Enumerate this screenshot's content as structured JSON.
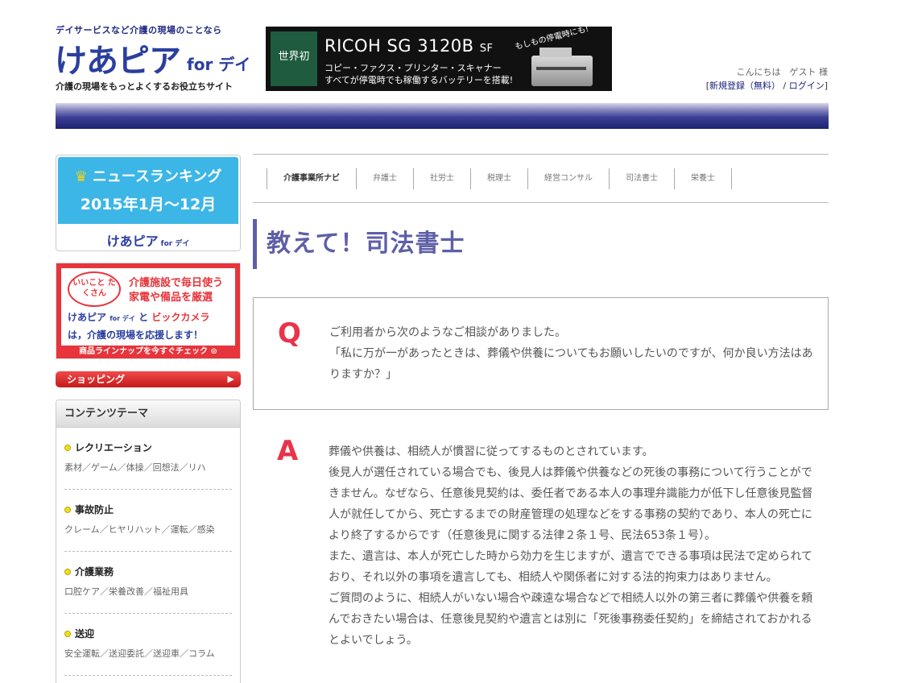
{
  "header": {
    "tagline": "デイサービスなど介護の現場のことなら",
    "logo_main": "けあピア",
    "logo_for": "for デイ",
    "logo_sub": "介護の現場をもっとよくするお役立ちサイト",
    "greeting": "こんにちは　ゲスト 様",
    "register_label": "新規登録（無料）",
    "login_label": "ログイン"
  },
  "banner": {
    "badge": "世界初",
    "title": "RICOH SG 3120B",
    "title_suffix": "SF",
    "line1": "コピー・ファクス・プリンター・スキャナー",
    "line2": "すべてが停電時でも稼働するバッテリーを搭載!",
    "callout": "もしもの停電時にも!"
  },
  "sidebar": {
    "ranking": {
      "title": "ニュースランキング",
      "period": "2015年1月〜12月",
      "logo": "けあピア",
      "logo_for": "for デイ"
    },
    "ad": {
      "bubble": "いいこと たくさん",
      "headline_1": "介護施設で毎日使う",
      "headline_2": "家電や備品を厳選",
      "partner_line_a": "けあピア",
      "partner_line_for": "for デイ",
      "partner_line_b": "と",
      "partner_brand": "ビックカメラ",
      "support_line": "は，介護の現場を応援します！",
      "cta": "商品ラインナップを今すぐチェック"
    },
    "shopping_label": "ショッピング",
    "theme": {
      "heading": "コンテンツテーマ",
      "items": [
        {
          "title": "レクリエーション",
          "sub": "素材／ゲーム／体操／回想法／リハ"
        },
        {
          "title": "事故防止",
          "sub": "クレーム／ヒヤリハット／運転／感染"
        },
        {
          "title": "介護業務",
          "sub": "口腔ケア／栄養改善／福祉用具"
        },
        {
          "title": "送迎",
          "sub": "安全運転／送迎委託／送迎車／コラム"
        }
      ]
    }
  },
  "main": {
    "tabs": [
      {
        "label": "介護事業所ナビ"
      },
      {
        "label": "弁護士"
      },
      {
        "label": "社労士"
      },
      {
        "label": "税理士"
      },
      {
        "label": "経営コンサル"
      },
      {
        "label": "司法書士"
      },
      {
        "label": "栄養士"
      }
    ],
    "page_title": "教えて！司法書士",
    "question": {
      "mark": "Q",
      "lines": [
        "ご利用者から次のようなご相談がありました。",
        "「私に万が一があったときは、葬儀や供養についてもお願いしたいのですが、何か良い方法はありますか？」"
      ]
    },
    "answer": {
      "mark": "A",
      "paragraphs": [
        "葬儀や供養は、相続人が慣習に従ってするものとされています。",
        "後見人が選任されている場合でも、後見人は葬儀や供養などの死後の事務について行うことができません。なぜなら、任意後見契約は、委任者である本人の事理弁識能力が低下し任意後見監督人が就任してから、死亡するまでの財産管理の処理などをする事務の契約であり、本人の死亡により終了するからです（任意後見に関する法律２条１号、民法653条１号）。",
        "また、遺言は、本人が死亡した時から効力を生じますが、遺言でできる事項は民法で定められており、それ以外の事項を遺言しても、相続人や関係者に対する法的拘束力はありません。",
        "ご質問のように、相続人がいない場合や疎遠な場合などで相続人以外の第三者に葬儀や供養を頼んでおきたい場合は、任意後見契約や遺言とは別に「死後事務委任契約」を締結されておかれるとよいでしょう。"
      ]
    }
  }
}
